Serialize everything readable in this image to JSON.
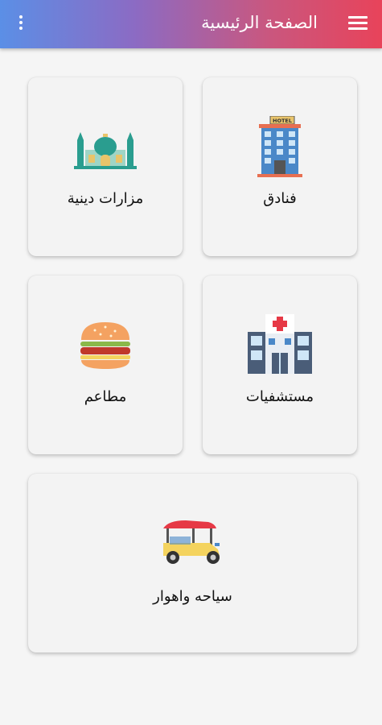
{
  "header": {
    "title": "الصفحة الرئيسية"
  },
  "cards": [
    {
      "label": "فنادق",
      "icon": "hotel-icon",
      "sign": "HOTEL"
    },
    {
      "label": "مزارات دينية",
      "icon": "mosque-icon"
    },
    {
      "label": "مستشفيات",
      "icon": "hospital-icon"
    },
    {
      "label": "مطاعم",
      "icon": "burger-icon"
    },
    {
      "label": "سياحه واهوار",
      "icon": "tuk-tuk-icon"
    }
  ],
  "colors": {
    "gradient_start": "#5b8fe6",
    "gradient_end": "#e8435a",
    "card_bg": "#f3f3f3"
  }
}
